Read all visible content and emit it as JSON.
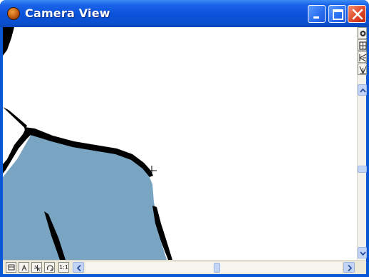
{
  "window": {
    "title": "Camera View",
    "icon": "camera-app-icon"
  },
  "title_buttons": [
    "minimize-icon",
    "maximize-icon",
    "close-icon"
  ],
  "canvas": {
    "description_colors": {
      "background": "#ffffff",
      "fill": "#7aa5c2",
      "outline": "#000000"
    },
    "cursor": "crosshair-icon"
  },
  "right_toolbar": [
    "camera-icon",
    "film-icon",
    "onion-skin-back-icon",
    "onion-skin-forward-icon"
  ],
  "bottom_toolbar": {
    "tools": [
      "reset-view-icon",
      "zoom-icon",
      "pan-icon",
      "rotate-icon"
    ],
    "ratio_label": "1:1"
  },
  "scrollbars": {
    "vertical_position": 0.55,
    "horizontal_position": 0.5
  }
}
